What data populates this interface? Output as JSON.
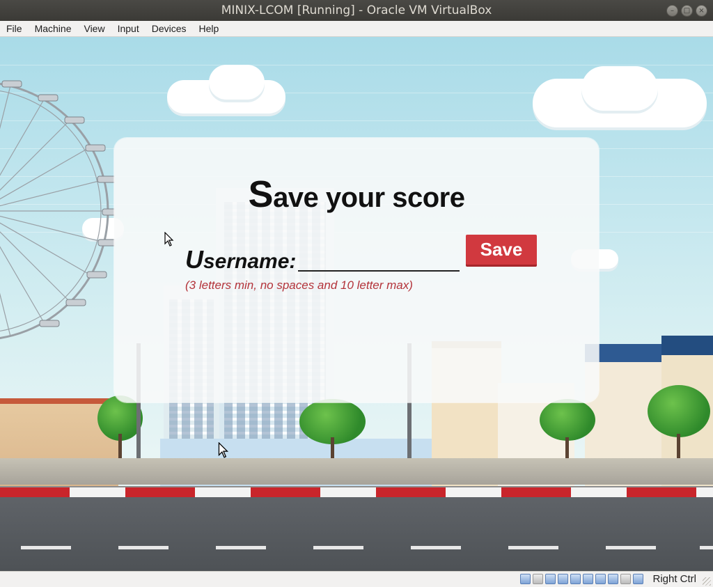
{
  "window": {
    "title": "MINIX-LCOM [Running] - Oracle VM VirtualBox",
    "buttons": [
      "minimize-icon",
      "maximize-icon",
      "close-icon"
    ]
  },
  "menubar": {
    "items": [
      {
        "label": "File"
      },
      {
        "label": "Machine"
      },
      {
        "label": "View"
      },
      {
        "label": "Input"
      },
      {
        "label": "Devices"
      },
      {
        "label": "Help"
      }
    ]
  },
  "dialog": {
    "title_first": "S",
    "title_rest": "ave your score",
    "username_first": "U",
    "username_rest": "sername:",
    "username_value": "",
    "save_label": "Save",
    "hint": "(3 letters min, no spaces and 10 letter max)"
  },
  "statusbar": {
    "icons": [
      "hard-disk-icon",
      "optical-drive-icon",
      "audio-icon",
      "network-icon",
      "usb-icon",
      "shared-folders-icon",
      "display-icon",
      "video-capture-icon",
      "cpu-icon",
      "mouse-integration-icon"
    ],
    "host_key": "Right Ctrl"
  },
  "colors": {
    "save_button": "#d1393f",
    "hint_text": "#b3333a",
    "title_bar": "#3b3a36",
    "sky": "#a9dbe8"
  }
}
